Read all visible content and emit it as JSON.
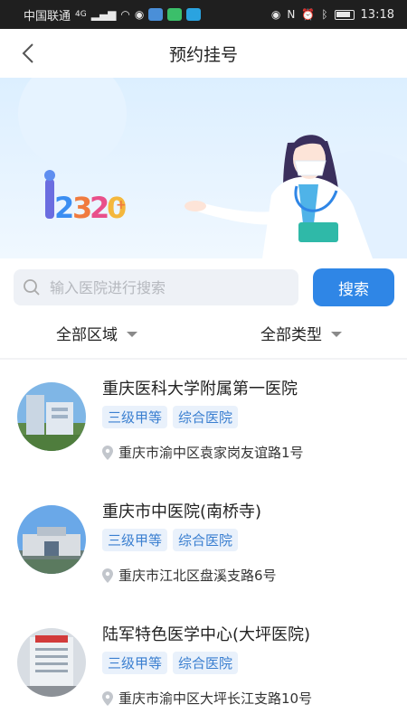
{
  "status_bar": {
    "carrier": "中国联通",
    "network": "4G",
    "time": "13:18"
  },
  "header": {
    "title": "预约挂号",
    "back_icon": "chevron-left-icon"
  },
  "banner": {
    "logo_text": "12320"
  },
  "search": {
    "placeholder": "输入医院进行搜索",
    "button_label": "搜索"
  },
  "filters": {
    "region": "全部区域",
    "type": "全部类型"
  },
  "hospitals": [
    {
      "name": "重庆医科大学附属第一医院",
      "tags": [
        "三级甲等",
        "综合医院"
      ],
      "address": "重庆市渝中区袁家岗友谊路1号"
    },
    {
      "name": "重庆市中医院(南桥寺)",
      "tags": [
        "三级甲等",
        "综合医院"
      ],
      "address": "重庆市江北区盘溪支路6号"
    },
    {
      "name": "陆军特色医学中心(大坪医院)",
      "tags": [
        "三级甲等",
        "综合医院"
      ],
      "address": "重庆市渝中区大坪长江支路10号"
    }
  ],
  "colors": {
    "accent": "#2f86e6",
    "tag_bg": "#e9f1fb",
    "tag_text": "#3a7fd0"
  }
}
